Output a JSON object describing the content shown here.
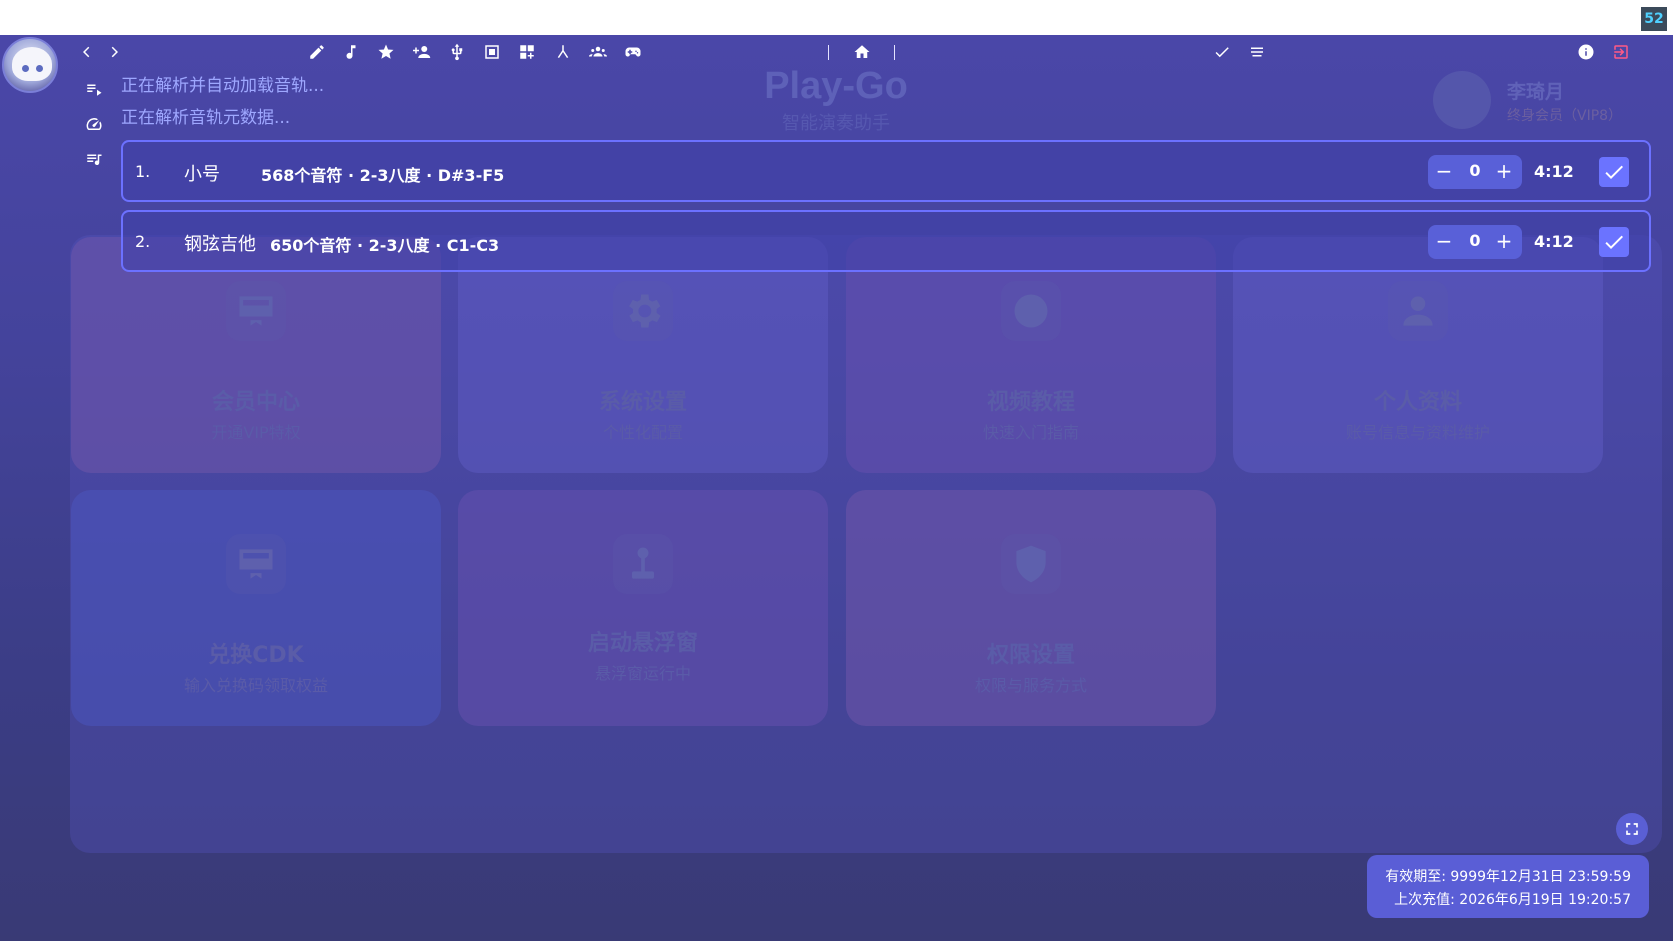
{
  "overlay": {
    "fps": "52"
  },
  "toolbar": {
    "icons": [
      "back-icon",
      "forward-icon",
      "pencil-icon",
      "music-note-icon",
      "star-icon",
      "add-person-icon",
      "usb-icon",
      "screenshot-icon",
      "grid-plus-icon",
      "split-icon",
      "group-icon",
      "gamepad-icon",
      "home-icon",
      "check-icon",
      "menu-icon",
      "info-icon",
      "exit-icon"
    ]
  },
  "status": {
    "line1": "正在解析并自动加载音轨...",
    "line2": "正在解析音轨元数据..."
  },
  "background": {
    "app_title": "Play-Go",
    "app_subtitle": "智能演奏助手",
    "user_name": "李琦月",
    "user_tag": "终身会员（VIP8）",
    "cards": [
      {
        "title": "会员中心",
        "subtitle": "开通VIP特权",
        "icon": "card-icon"
      },
      {
        "title": "系统设置",
        "subtitle": "个性化配置",
        "icon": "gear-icon"
      },
      {
        "title": "视频教程",
        "subtitle": "快速入门指南",
        "icon": "play-icon"
      },
      {
        "title": "个人资料",
        "subtitle": "账号信息与资料维护",
        "icon": "person-icon"
      },
      {
        "title": "兑换CDK",
        "subtitle": "输入兑换码领取权益",
        "icon": "card-icon"
      },
      {
        "title": "启动悬浮窗",
        "subtitle": "悬浮窗运行中",
        "icon": "joystick-icon"
      },
      {
        "title": "权限设置",
        "subtitle": "权限与服务方式",
        "icon": "shield-icon"
      }
    ]
  },
  "tracks": [
    {
      "num": "1.",
      "name": "小号",
      "meta": "568个音符 · 2-3八度 · D#3-F5",
      "transpose": "0",
      "duration": "4:12",
      "checked": true
    },
    {
      "num": "2.",
      "name": "钢弦吉他",
      "meta": "650个音符 · 2-3八度 · C1-C3",
      "transpose": "0",
      "duration": "4:12",
      "checked": true
    }
  ],
  "stepper": {
    "minus": "−",
    "plus": "+"
  },
  "info": {
    "expiry": "有效期至: 9999年12月31日 23:59:59",
    "last_recharge": "上次充值: 2026年6月19日 19:20:57"
  }
}
